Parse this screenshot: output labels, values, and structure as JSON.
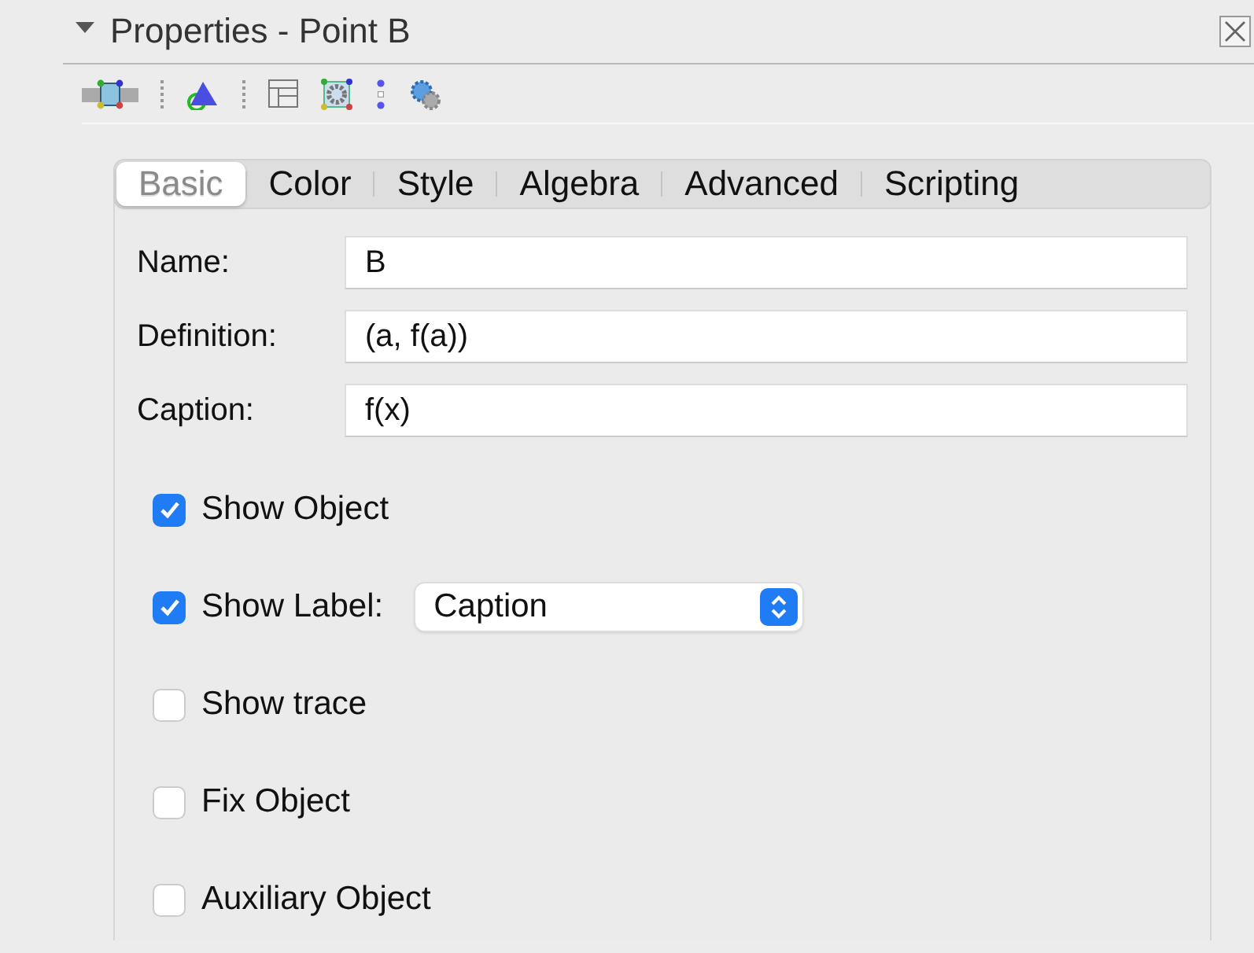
{
  "panel": {
    "title": "Properties - Point B",
    "expanded": true
  },
  "toolbar": {
    "items": [
      {
        "kind": "icon",
        "selected": true
      },
      {
        "kind": "separator"
      },
      {
        "kind": "icon",
        "selected": false
      },
      {
        "kind": "separator"
      },
      {
        "kind": "icon",
        "selected": false
      },
      {
        "kind": "icon",
        "selected": false
      },
      {
        "kind": "icon",
        "selected": false
      },
      {
        "kind": "icon",
        "selected": false
      }
    ]
  },
  "tabs": [
    {
      "label": "Basic",
      "selected": true
    },
    {
      "label": "Color",
      "selected": false
    },
    {
      "label": "Style",
      "selected": false
    },
    {
      "label": "Algebra",
      "selected": false
    },
    {
      "label": "Advanced",
      "selected": false
    },
    {
      "label": "Scripting",
      "selected": false
    }
  ],
  "fields": [
    {
      "label": "Name:",
      "value": "B"
    },
    {
      "label": "Definition:",
      "value": "(a, f(a))"
    },
    {
      "label": "Caption:",
      "value": "f(x)"
    }
  ],
  "options": [
    {
      "label": "Show Object",
      "checked": true
    },
    {
      "label": "Show Label:",
      "checked": true,
      "dropdown": "Caption"
    },
    {
      "label": "Show trace",
      "checked": false
    },
    {
      "label": "Fix Object",
      "checked": false
    },
    {
      "label": "Auxiliary Object",
      "checked": false
    }
  ]
}
